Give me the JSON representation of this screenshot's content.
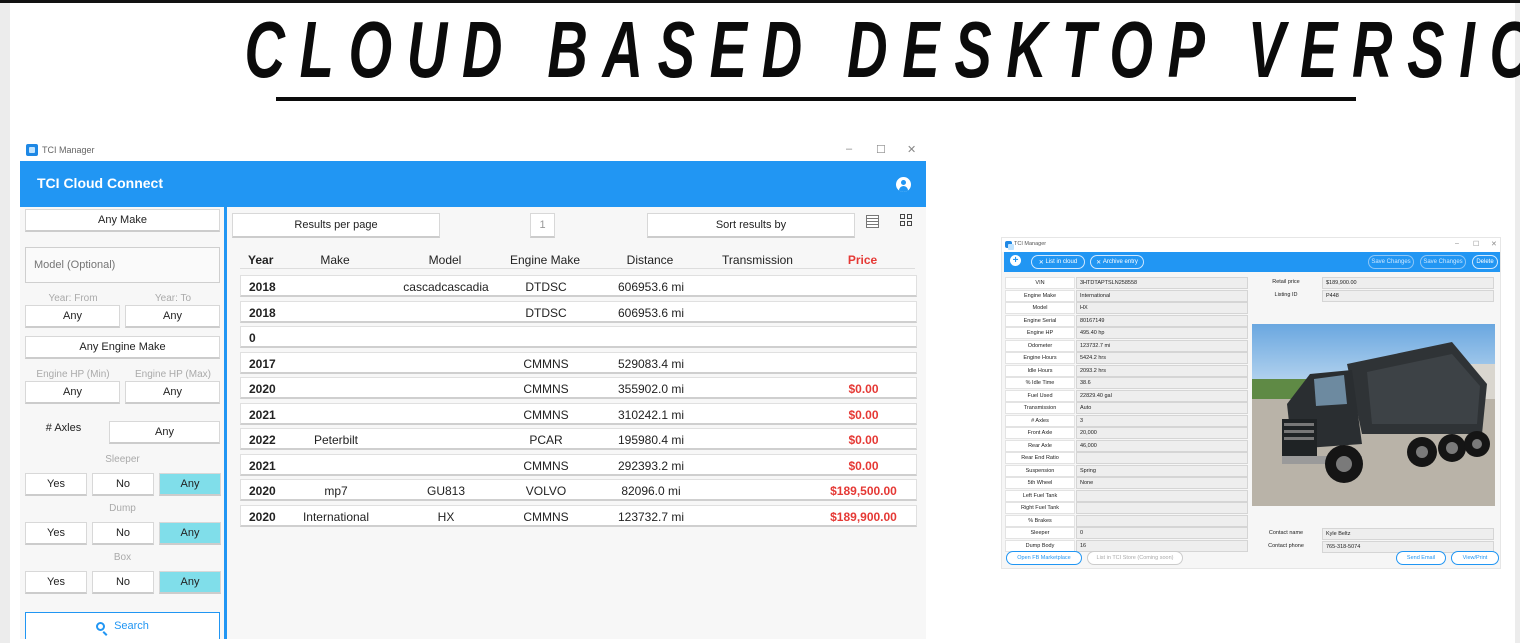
{
  "headline": "CLOUD BASED DESKTOP VERSION",
  "main_window": {
    "title": "TCI Manager",
    "app_title": "TCI Cloud Connect",
    "controls": [
      "–",
      "☐",
      "✕"
    ],
    "sidebar": {
      "make": "Any Make",
      "model_placeholder": "Model (Optional)",
      "year_from_label": "Year: From",
      "year_to_label": "Year: To",
      "year_from": "Any",
      "year_to": "Any",
      "engine_make": "Any Engine Make",
      "hp_min_label": "Engine HP (Min)",
      "hp_max_label": "Engine HP (Max)",
      "hp_min": "Any",
      "hp_max": "Any",
      "axles_label": "# Axles",
      "axles": "Any",
      "sleeper_label": "Sleeper",
      "dump_label": "Dump",
      "box_label": "Box",
      "yes": "Yes",
      "no": "No",
      "any": "Any",
      "search": "Search"
    },
    "toolbar": {
      "results_per_page": "Results per page",
      "page": "1",
      "sort": "Sort results by"
    },
    "columns": [
      "Year",
      "Make",
      "Model",
      "Engine Make",
      "Distance",
      "Transmission",
      "Price"
    ],
    "rows": [
      {
        "year": "2018",
        "make": "",
        "model": "cascadcascadia",
        "engine": "DTDSC",
        "distance": "606953.6 mi",
        "transmission": "",
        "price": ""
      },
      {
        "year": "2018",
        "make": "",
        "model": "",
        "engine": "DTDSC",
        "distance": "606953.6 mi",
        "transmission": "",
        "price": ""
      },
      {
        "year": "0",
        "make": "",
        "model": "",
        "engine": "",
        "distance": "",
        "transmission": "",
        "price": ""
      },
      {
        "year": "2017",
        "make": "",
        "model": "",
        "engine": "CMMNS",
        "distance": "529083.4 mi",
        "transmission": "",
        "price": ""
      },
      {
        "year": "2020",
        "make": "",
        "model": "",
        "engine": "CMMNS",
        "distance": "355902.0 mi",
        "transmission": "",
        "price": "$0.00"
      },
      {
        "year": "2021",
        "make": "",
        "model": "",
        "engine": "CMMNS",
        "distance": "310242.1 mi",
        "transmission": "",
        "price": "$0.00"
      },
      {
        "year": "2022",
        "make": "Peterbilt",
        "model": "",
        "engine": "PCAR",
        "distance": "195980.4 mi",
        "transmission": "",
        "price": "$0.00"
      },
      {
        "year": "2021",
        "make": "",
        "model": "",
        "engine": "CMMNS",
        "distance": "292393.2 mi",
        "transmission": "",
        "price": "$0.00"
      },
      {
        "year": "2020",
        "make": "mp7",
        "model": "GU813",
        "engine": "VOLVO",
        "distance": "82096.0 mi",
        "transmission": "",
        "price": "$189,500.00"
      },
      {
        "year": "2020",
        "make": "International",
        "model": "HX",
        "engine": "CMMNS",
        "distance": "123732.7 mi",
        "transmission": "",
        "price": "$189,900.00"
      }
    ]
  },
  "detail_window": {
    "title": "TCI Manager",
    "actions": [
      "List in cloud",
      "Archive entry"
    ],
    "right_actions": [
      "Save Changes",
      "Save Changes",
      "Delete"
    ],
    "fields": [
      {
        "label": "VIN",
        "value": "3HTDTAPTSLN258558"
      },
      {
        "label": "Engine Make",
        "value": "International"
      },
      {
        "label": "Model",
        "value": "HX"
      },
      {
        "label": "Engine Serial",
        "value": "80167149"
      },
      {
        "label": "Engine HP",
        "value": "495.40 hp"
      },
      {
        "label": "Odometer",
        "value": "123732.7 mi"
      },
      {
        "label": "Engine Hours",
        "value": "5424.2 hrs"
      },
      {
        "label": "Idle Hours",
        "value": "2093.2 hrs"
      },
      {
        "label": "% Idle Time",
        "value": "38.6"
      },
      {
        "label": "Fuel Used",
        "value": "22829.40 gal"
      },
      {
        "label": "Transmission",
        "value": "Auto"
      },
      {
        "label": "# Axles",
        "value": "3"
      },
      {
        "label": "Front Axle",
        "value": "20,000"
      },
      {
        "label": "Rear Axle",
        "value": "46,000"
      },
      {
        "label": "Rear End Ratio",
        "value": ""
      },
      {
        "label": "Suspension",
        "value": "Spring"
      },
      {
        "label": "5th Wheel",
        "value": "None"
      },
      {
        "label": "Left Fuel Tank",
        "value": ""
      },
      {
        "label": "Right Fuel Tank",
        "value": ""
      },
      {
        "label": "% Brakes",
        "value": ""
      },
      {
        "label": "Sleeper",
        "value": "0"
      },
      {
        "label": "Dump Body",
        "value": "16"
      }
    ],
    "right_fields": [
      {
        "label": "Retail price",
        "value": "$189,900.00"
      },
      {
        "label": "Listing ID",
        "value": "P448"
      }
    ],
    "contact": [
      {
        "label": "Contact name",
        "value": "Kyle Beltz"
      },
      {
        "label": "Contact phone",
        "value": "765-318-5074"
      }
    ],
    "footer": [
      "Open FB Marketplace",
      "List in TCI Store (Coming soon)",
      "Send Email",
      "View/Print"
    ]
  },
  "colors": {
    "accent": "#2196f3",
    "price": "#e53935",
    "toggle_on": "#80deea"
  }
}
